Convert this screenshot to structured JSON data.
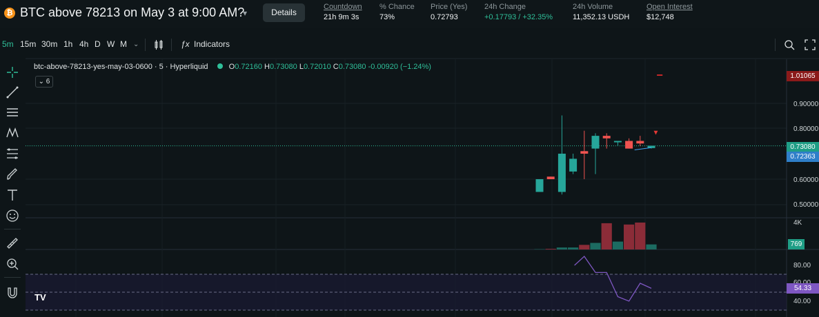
{
  "header": {
    "title": "BTC above 78213 on May 3 at 9:00 AM?",
    "details_label": "Details",
    "stats": [
      {
        "label": "Countdown",
        "value": "21h 9m 3s"
      },
      {
        "label": "% Chance",
        "value": "73%"
      },
      {
        "label": "Price (Yes)",
        "value": "0.72793"
      },
      {
        "label": "24h Change",
        "value": "+0.17793 / +32.35%"
      },
      {
        "label": "24h Volume",
        "value": "11,352.13 USDH"
      },
      {
        "label": "Open Interest",
        "value": "$12,748"
      }
    ]
  },
  "toolbar": {
    "intervals": [
      "5m",
      "15m",
      "30m",
      "1h",
      "4h",
      "D",
      "W",
      "M"
    ],
    "indicators_label": "Indicators"
  },
  "legend": {
    "symbol": "btc-above-78213-yes-may-03-0600 · 5 · Hyperliquid",
    "o_label": "O",
    "o": "0.72160",
    "h_label": "H",
    "h": "0.73080",
    "l_label": "L",
    "l": "0.72010",
    "c_label": "C",
    "c": "0.73080",
    "change": "-0.00920 (−1.24%)",
    "collapse_count": "6"
  },
  "axis": {
    "labels": [
      "0.90000",
      "0.80000",
      "0.60000",
      "0.50000"
    ],
    "volume_label": "4K",
    "rsi_labels": [
      "80.00",
      "60.00",
      "40.00"
    ]
  },
  "price_tags": {
    "high": "1.01065",
    "last": "0.73080",
    "ma": "0.72363",
    "volume": "769",
    "rsi": "54.33"
  },
  "colors": {
    "up": "#26a69a",
    "down": "#ef5350",
    "rsi": "#7e57c2"
  },
  "chart_data": {
    "type": "candlestick",
    "candles": [
      {
        "o": 0.55,
        "h": 0.6,
        "l": 0.55,
        "c": 0.6
      },
      {
        "o": 0.61,
        "h": 0.61,
        "l": 0.6,
        "c": 0.6
      },
      {
        "o": 0.55,
        "h": 0.85,
        "l": 0.54,
        "c": 0.7
      },
      {
        "o": 0.63,
        "h": 0.7,
        "l": 0.62,
        "c": 0.68
      },
      {
        "o": 0.71,
        "h": 0.79,
        "l": 0.6,
        "c": 0.7
      },
      {
        "o": 0.72,
        "h": 0.78,
        "l": 0.62,
        "c": 0.77
      },
      {
        "o": 0.77,
        "h": 0.78,
        "l": 0.72,
        "c": 0.76
      },
      {
        "o": 0.75,
        "h": 0.75,
        "l": 0.73,
        "c": 0.75
      },
      {
        "o": 0.75,
        "h": 0.76,
        "l": 0.72,
        "c": 0.72
      },
      {
        "o": 0.75,
        "h": 0.77,
        "l": 0.73,
        "c": 0.74
      },
      {
        "o": 0.722,
        "h": 0.731,
        "l": 0.72,
        "c": 0.731
      }
    ],
    "volume": [
      50,
      100,
      300,
      300,
      700,
      1000,
      4000,
      1200,
      3800,
      4100,
      769
    ],
    "rsi": [
      null,
      null,
      null,
      80,
      90,
      72,
      72,
      45,
      40,
      60,
      54.33
    ]
  }
}
